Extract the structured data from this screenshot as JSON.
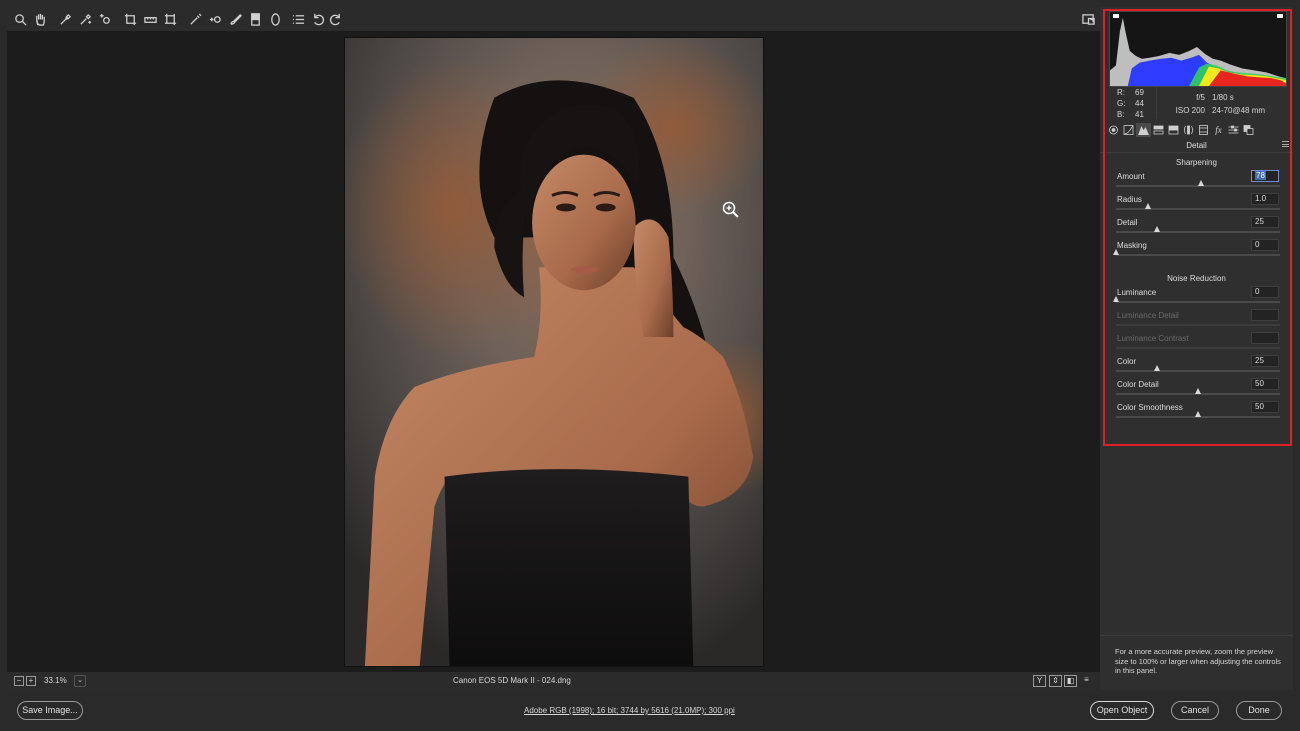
{
  "toolbar": {
    "tools": [
      "zoom-icon",
      "hand-icon",
      "white-balance-icon",
      "color-sampler-icon",
      "targeted-adjustment-icon",
      "crop-icon",
      "straighten-icon",
      "transform-icon",
      "spot-removal-icon",
      "red-eye-icon",
      "adjustment-brush-icon",
      "graduated-filter-icon",
      "radial-filter-icon",
      "preferences-icon",
      "rotate-left-icon",
      "rotate-right-icon"
    ],
    "fullscreen_icon": "fullscreen-icon"
  },
  "histogram": {
    "channels": [
      "red",
      "green",
      "blue",
      "luminance"
    ],
    "colors": {
      "red": "#e8261f",
      "green": "#2fd05a",
      "blue": "#2d3cff",
      "yellow": "#f2e81e",
      "gray": "#d0d0d0"
    }
  },
  "readout": {
    "r_label": "R:",
    "r_value": "69",
    "g_label": "G:",
    "g_value": "44",
    "b_label": "B:",
    "b_value": "41"
  },
  "exif": {
    "aperture": "f/5",
    "shutter": "1/80 s",
    "iso": "ISO 200",
    "lens": "24-70@48 mm"
  },
  "panel": {
    "title": "Detail",
    "tabs": [
      "basic-icon",
      "tone-curve-icon",
      "detail-icon",
      "hsl-icon",
      "split-toning-icon",
      "lens-corrections-icon",
      "effects-icon",
      "camera-calibration-icon",
      "presets-icon",
      "snapshots-icon"
    ],
    "active_tab": 2
  },
  "sharpening": {
    "title": "Sharpening",
    "controls": [
      {
        "label": "Amount",
        "value": "78",
        "position": 0.52,
        "selected": true
      },
      {
        "label": "Radius",
        "value": "1.0",
        "position": 0.2
      },
      {
        "label": "Detail",
        "value": "25",
        "position": 0.25
      },
      {
        "label": "Masking",
        "value": "0",
        "position": 0.0
      }
    ]
  },
  "noise": {
    "title": "Noise Reduction",
    "controls": [
      {
        "label": "Luminance",
        "value": "0",
        "position": 0.0
      },
      {
        "label": "Luminance Detail",
        "value": "",
        "position": null,
        "disabled": true
      },
      {
        "label": "Luminance Contrast",
        "value": "",
        "position": null,
        "disabled": true
      },
      {
        "label": "Color",
        "value": "25",
        "position": 0.25
      },
      {
        "label": "Color Detail",
        "value": "50",
        "position": 0.5
      },
      {
        "label": "Color Smoothness",
        "value": "50",
        "position": 0.5
      }
    ]
  },
  "hint": "For a more accurate preview, zoom the preview size to 100% or larger when adjusting the controls in this panel.",
  "status": {
    "zoom_out": "−",
    "zoom_in": "+",
    "zoom_level": "33.1%",
    "filename": "Canon EOS 5D Mark II  -  024.dng",
    "view_buttons": [
      "Y",
      "⇕",
      "◧",
      "≡"
    ]
  },
  "bottom": {
    "save_label": "Save Image...",
    "workflow": "Adobe RGB (1998); 16 bit; 3744 by 5616 (21.0MP); 300 ppi",
    "open_label": "Open Object",
    "cancel_label": "Cancel",
    "done_label": "Done"
  },
  "accent_color": "#e01f26"
}
